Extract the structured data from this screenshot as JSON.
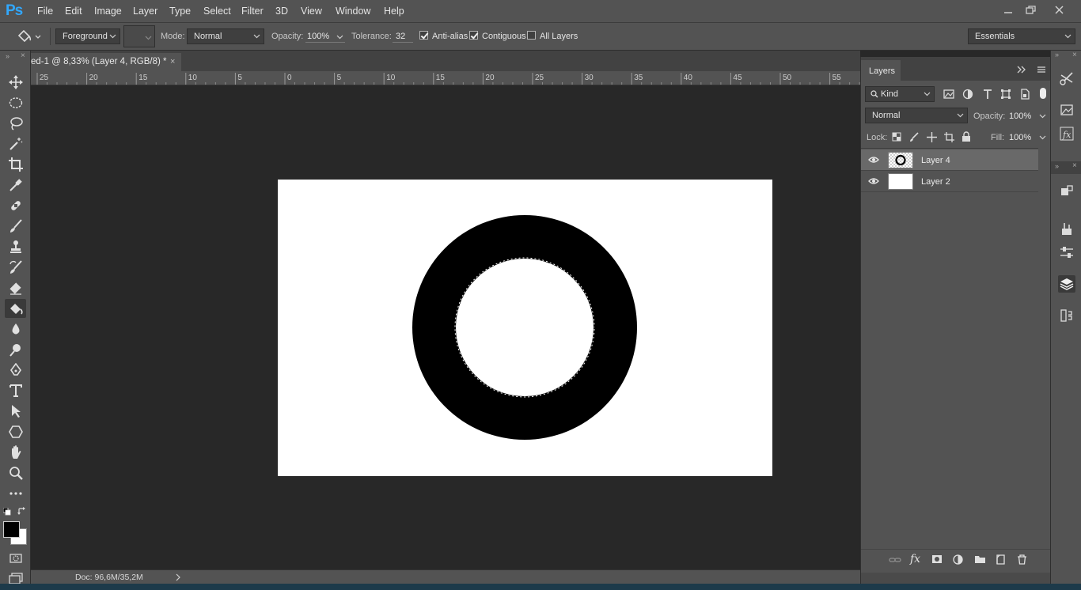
{
  "app": {
    "logo": "Ps"
  },
  "menu": [
    "File",
    "Edit",
    "Image",
    "Layer",
    "Type",
    "Select",
    "Filter",
    "3D",
    "View",
    "Window",
    "Help"
  ],
  "options": {
    "fill_source": "Foreground",
    "mode_label": "Mode:",
    "mode_value": "Normal",
    "opacity_label": "Opacity:",
    "opacity_value": "100%",
    "tolerance_label": "Tolerance:",
    "tolerance_value": "32",
    "anti_alias_label": "Anti-alias",
    "anti_alias_checked": true,
    "contiguous_label": "Contiguous",
    "contiguous_checked": true,
    "all_layers_label": "All Layers",
    "all_layers_checked": false,
    "workspace": "Essentials"
  },
  "document": {
    "tab_title": "ed-1 @ 8,33% (Layer 4, RGB/8) *",
    "close_glyph": "×",
    "status": "Doc: 96,6M/35,2M"
  },
  "ruler": {
    "ticks": [
      "25",
      "20",
      "15",
      "10",
      "5",
      "0",
      "5",
      "10",
      "15",
      "20",
      "25",
      "30",
      "35",
      "40",
      "45",
      "50",
      "55"
    ]
  },
  "layers_panel": {
    "tab": "Layers",
    "filter_kind": "Kind",
    "blend_mode": "Normal",
    "opacity_label": "Opacity:",
    "opacity_value": "100%",
    "lock_label": "Lock:",
    "fill_label": "Fill:",
    "fill_value": "100%",
    "layers": [
      {
        "name": "Layer 4",
        "selected": true,
        "visible": true
      },
      {
        "name": "Layer 2",
        "selected": false,
        "visible": true
      }
    ]
  },
  "colors": {
    "foreground": "#000000",
    "background": "#ffffff",
    "ui_panel": "#535353",
    "ui_dark": "#282828",
    "accent": "#31a8ff"
  }
}
